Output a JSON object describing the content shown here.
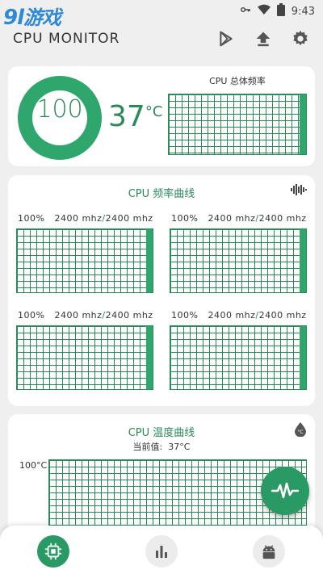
{
  "status_bar": {
    "watermark_brand": "9l",
    "watermark_text": "游戏",
    "time": "9:43"
  },
  "app_bar": {
    "title": "CPU MONITOR"
  },
  "overview": {
    "usage": "100",
    "temperature": "37",
    "temperature_unit": "°C",
    "freq_title": "CPU 总体频率"
  },
  "freq_card": {
    "title": "CPU 频率曲线",
    "cores": [
      {
        "usage": "100%",
        "freq": "2400 mhz",
        "max": "2400 mhz"
      },
      {
        "usage": "100%",
        "freq": "2400 mhz",
        "max": "2400 mhz"
      },
      {
        "usage": "100%",
        "freq": "2400 mhz",
        "max": "2400 mhz"
      },
      {
        "usage": "100%",
        "freq": "2400 mhz",
        "max": "2400 mhz"
      }
    ]
  },
  "temp_card": {
    "title": "CPU 温度曲线",
    "current_label": "当前值:",
    "current_value": "37°C",
    "y_top": "100°C"
  },
  "colors": {
    "accent": "#2a8a58",
    "accent_fill": "#2fa66b",
    "watermark": "#2f8ad6"
  },
  "icons": [
    "key-icon",
    "wifi-icon",
    "battery-icon",
    "play-store-icon",
    "upload-icon",
    "settings-icon",
    "waveform-icon",
    "thermometer-icon",
    "pulse-icon",
    "cpu-chip-icon",
    "bar-chart-icon",
    "android-icon"
  ]
}
